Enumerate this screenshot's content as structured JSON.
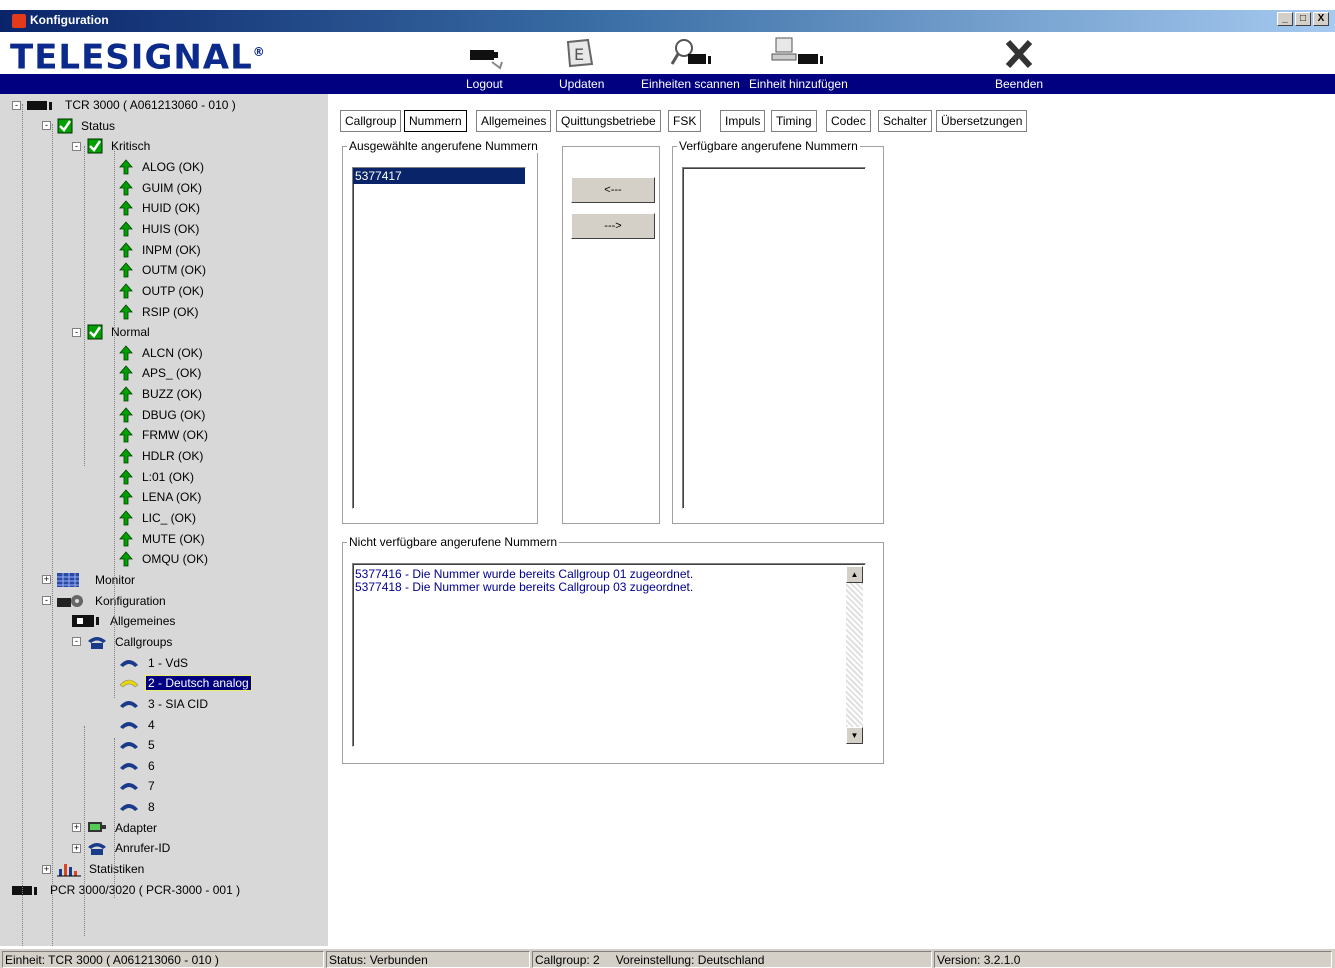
{
  "window": {
    "title": "Konfiguration",
    "controls": [
      "_",
      "□",
      "X"
    ]
  },
  "logo": {
    "text": "TELESIGNAL",
    "mark": "®"
  },
  "toolbar": {
    "logout": "Logout",
    "update": "Updaten",
    "scan": "Einheiten scannen",
    "add_unit": "Einheit hinzufügen",
    "exit": "Beenden"
  },
  "tree": {
    "root": "TCR 3000 ( A061213060 - 010 )",
    "status": "Status",
    "kritisch": "Kritisch",
    "kritisch_items": [
      "ALOG (OK)",
      "GUIM (OK)",
      "HUID (OK)",
      "HUIS (OK)",
      "INPM (OK)",
      "OUTM (OK)",
      "OUTP (OK)",
      "RSIP (OK)"
    ],
    "normal": "Normal",
    "normal_items": [
      "ALCN (OK)",
      "APS_ (OK)",
      "BUZZ (OK)",
      "DBUG (OK)",
      "FRMW (OK)",
      "HDLR (OK)",
      "L:01 (OK)",
      "LENA (OK)",
      "LIC_ (OK)",
      "MUTE (OK)",
      "OMQU (OK)"
    ],
    "monitor": "Monitor",
    "konfiguration": "Konfiguration",
    "allgemeines": "Allgemeines",
    "callgroups": "Callgroups",
    "callgroup_items": [
      "1 - VdS",
      "2 - Deutsch analog",
      "3 - SIA CID",
      "4",
      "5",
      "6",
      "7",
      "8"
    ],
    "adapter": "Adapter",
    "anrufer_id": "Anrufer-ID",
    "statistiken": "Statistiken",
    "root2": "PCR 3000/3020 ( PCR-3000 - 001 )"
  },
  "tabs": [
    "Callgroup",
    "Nummern",
    "Allgemeines",
    "Quittungsbetriebe",
    "FSK",
    "Impuls",
    "Timing",
    "Codec",
    "Schalter",
    "Übersetzungen"
  ],
  "active_tab": "Nummern",
  "selected_numbers": {
    "title": "Ausgewählte angerufene Nummern",
    "items": [
      "5377417"
    ]
  },
  "move_buttons": {
    "left": "<---",
    "right": "--->"
  },
  "available_numbers": {
    "title": "Verfügbare angerufene Nummern",
    "items": []
  },
  "unavailable_numbers": {
    "title": "Nicht verfügbare angerufene Nummern",
    "lines": [
      "5377416 - Die Nummer wurde bereits Callgroup 01 zugeordnet.",
      "5377418 - Die Nummer wurde bereits Callgroup 03 zugeordnet."
    ]
  },
  "statusbar": {
    "unit": "Einheit: TCR 3000 ( A061213060 - 010 )",
    "status": "Status: Verbunden",
    "callgroup": "Callgroup: 2",
    "preset": "Voreinstellung: Deutschland",
    "version": "Version: 3.2.1.0"
  },
  "colors": {
    "titlebar_start": "#0a246a",
    "toolbar_band": "#000080",
    "tree_bg": "#d8d8d8",
    "ok_arrow": "#00a000",
    "phone": "#1a3a8a",
    "phone_selected": "#e8d800",
    "message_text": "#00008b"
  },
  "icons": {
    "ok": "up-arrow-icon",
    "check": "checkbox-checked-icon",
    "device": "device-icon",
    "phone": "phone-icon"
  }
}
